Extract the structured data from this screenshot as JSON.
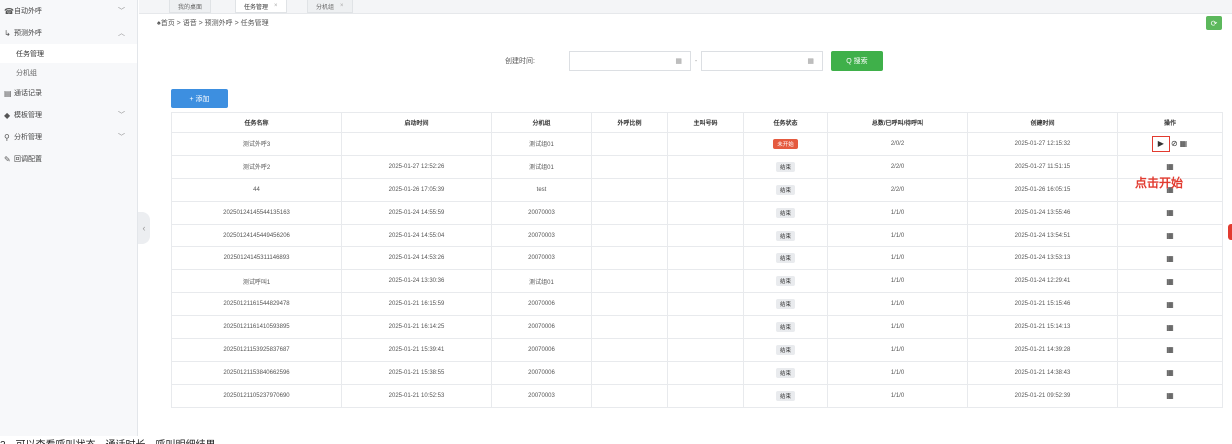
{
  "sidebar": {
    "items": [
      {
        "icon": "phone-icon",
        "label": "自动外呼",
        "chevron": "﹀"
      },
      {
        "icon": "predict-icon",
        "label": "预测外呼",
        "chevron": "︿"
      },
      {
        "sub": true,
        "label": "任务管理",
        "active": true
      },
      {
        "sub": true,
        "label": "分机组"
      },
      {
        "icon": "record-icon",
        "label": "通话记录"
      },
      {
        "icon": "model-icon",
        "label": "模板管理",
        "chevron": "﹀"
      },
      {
        "icon": "analysis-icon",
        "label": "分析管理",
        "chevron": "﹀"
      },
      {
        "icon": "setting-icon",
        "label": "回调配置"
      }
    ]
  },
  "tabs": [
    {
      "label": "我的桌面"
    },
    {
      "label": "任务管理",
      "close": "×",
      "active": true
    },
    {
      "label": "分机组",
      "close": "×"
    }
  ],
  "breadcrumb": "♠首页 > 语音 > 预测外呼 > 任务管理",
  "search": {
    "label": "创建时间:",
    "dash": "-",
    "button": "Q 搜索"
  },
  "add_button": "+ 添加",
  "table": {
    "columns": [
      "任务名称",
      "启动时间",
      "分机组",
      "外呼比例",
      "主叫号码",
      "任务状态",
      "总数/已呼叫/待呼叫",
      "创建时间",
      "操作"
    ],
    "rows": [
      [
        "测试外呼3",
        "",
        "测试组01",
        "",
        "",
        "未开始",
        "2/0/2",
        "2025-01-27 12:15:32"
      ],
      [
        "测试外呼2",
        "2025-01-27 12:52:26",
        "测试组01",
        "",
        "",
        "结束",
        "2/2/0",
        "2025-01-27 11:51:15"
      ],
      [
        "44",
        "2025-01-26 17:05:39",
        "test",
        "",
        "",
        "结束",
        "2/2/0",
        "2025-01-26 16:05:15"
      ],
      [
        "20250124145544135163",
        "2025-01-24 14:55:59",
        "20070003",
        "",
        "",
        "结束",
        "1/1/0",
        "2025-01-24 13:55:46"
      ],
      [
        "20250124145449456206",
        "2025-01-24 14:55:04",
        "20070003",
        "",
        "",
        "结束",
        "1/1/0",
        "2025-01-24 13:54:51"
      ],
      [
        "20250124145311146893",
        "2025-01-24 14:53:26",
        "20070003",
        "",
        "",
        "结束",
        "1/1/0",
        "2025-01-24 13:53:13"
      ],
      [
        "测试呼叫1",
        "2025-01-24 13:30:36",
        "测试组01",
        "",
        "",
        "结束",
        "1/1/0",
        "2025-01-24 12:29:41"
      ],
      [
        "20250121161544829478",
        "2025-01-21 16:15:59",
        "20070006",
        "",
        "",
        "结束",
        "1/1/0",
        "2025-01-21 15:15:46"
      ],
      [
        "20250121161410593895",
        "2025-01-21 16:14:25",
        "20070006",
        "",
        "",
        "结束",
        "1/1/0",
        "2025-01-21 15:14:13"
      ],
      [
        "20250121153925837687",
        "2025-01-21 15:39:41",
        "20070006",
        "",
        "",
        "结束",
        "1/1/0",
        "2025-01-21 14:39:28"
      ],
      [
        "20250121153840662596",
        "2025-01-21 15:38:55",
        "20070006",
        "",
        "",
        "结束",
        "1/1/0",
        "2025-01-21 14:38:43"
      ],
      [
        "20250121105237970690",
        "2025-01-21 10:52:53",
        "20070003",
        "",
        "",
        "结束",
        "1/1/0",
        "2025-01-21 09:52:39"
      ]
    ]
  },
  "annotation": "点击开始",
  "caption": "2、可以查看呼叫状态、通话时长、呼叫明细结果",
  "icons": {
    "play": "▶",
    "stop": "⊘",
    "detail": "▦",
    "refresh": "⟳",
    "collapse": "‹",
    "calendar": "▦"
  },
  "colors": {
    "accent_green": "#3fb04a",
    "accent_blue": "#3d8fe0",
    "badge_red": "#e55a3f",
    "annotation_red": "#e23b30"
  }
}
